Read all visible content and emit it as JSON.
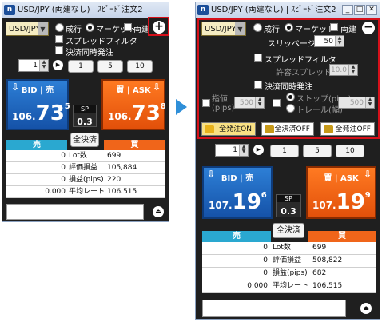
{
  "left_window": {
    "title": "USD/JPY (両建なし) | ｽﾋﾟｰﾄﾞ注文2",
    "pair": "USD/JPY",
    "order_types": {
      "limit_label": "成行",
      "market_label": "マーケット"
    },
    "hedge_label": "両建",
    "spread_filter_label": "スプレッドフィルタ",
    "settle_simul_label": "決済同時発注",
    "expand_button": "+",
    "lot_value": "1",
    "quick_lots": [
      "1",
      "5",
      "10"
    ],
    "bid": {
      "header": "BID | 売",
      "prefix": "106.",
      "big": "73",
      "sup": "5"
    },
    "ask": {
      "header": "買 | ASK",
      "prefix": "106.",
      "big": "73",
      "sup": "8"
    },
    "sp": {
      "label": "SP",
      "value": "0.3"
    },
    "close_all_label": "全決済",
    "sell_header": "売",
    "buy_header": "買",
    "rows": [
      {
        "sell": "0",
        "label": "Lot数",
        "buy": "699"
      },
      {
        "sell": "0",
        "label": "評価損益",
        "buy": "105,884"
      },
      {
        "sell": "0",
        "label": "損益(pips)",
        "buy": "220"
      },
      {
        "sell": "0.000",
        "label": "平均レート",
        "buy": "106.515"
      }
    ]
  },
  "right_window": {
    "title": "USD/JPY (両建なし) | ｽﾋﾟｰﾄﾞ注文2",
    "pair": "USD/JPY",
    "order_types": {
      "limit_label": "成行",
      "market_label": "マーケット"
    },
    "hedge_label": "両建",
    "slippage_label": "スリッページ",
    "slippage_value": "50",
    "spread_filter_label": "スプレッドフィルタ",
    "allowed_spread_label": "許容スプレッド",
    "allowed_spread_value": "10.0",
    "settle_simul_label": "決済同時発注",
    "limit_pips_label": "指値\n(pips)",
    "limit_pips_value": "500",
    "limit_pips_value2": "500",
    "stop_label": "ストップ(pips)",
    "trail_label": "トレール(幅)",
    "stop_value": "500",
    "collapse_button": "−",
    "all_on_label": "全発注ON",
    "settle_off_label": "全決済OFF",
    "all_off_label": "全発注OFF",
    "lot_value": "1",
    "quick_lots": [
      "1",
      "5",
      "10"
    ],
    "bid": {
      "header": "BID | 売",
      "prefix": "107.",
      "big": "19",
      "sup": "6"
    },
    "ask": {
      "header": "買 | ASK",
      "prefix": "107.",
      "big": "19",
      "sup": "9"
    },
    "sp": {
      "label": "SP",
      "value": "0.3"
    },
    "close_all_label": "全決済",
    "sell_header": "売",
    "buy_header": "買",
    "rows": [
      {
        "sell": "0",
        "label": "Lot数",
        "buy": "699"
      },
      {
        "sell": "0",
        "label": "評価損益",
        "buy": "508,822"
      },
      {
        "sell": "0",
        "label": "損益(pips)",
        "buy": "682"
      },
      {
        "sell": "0.000",
        "label": "平均レート",
        "buy": "106.515"
      }
    ]
  },
  "colors": {
    "bid_blue": "#1a5fb8",
    "ask_orange": "#f0651a",
    "highlight_red": "#d6101a",
    "table_header_blue": "#2aa8d0",
    "table_header_orange": "#f0651a"
  }
}
